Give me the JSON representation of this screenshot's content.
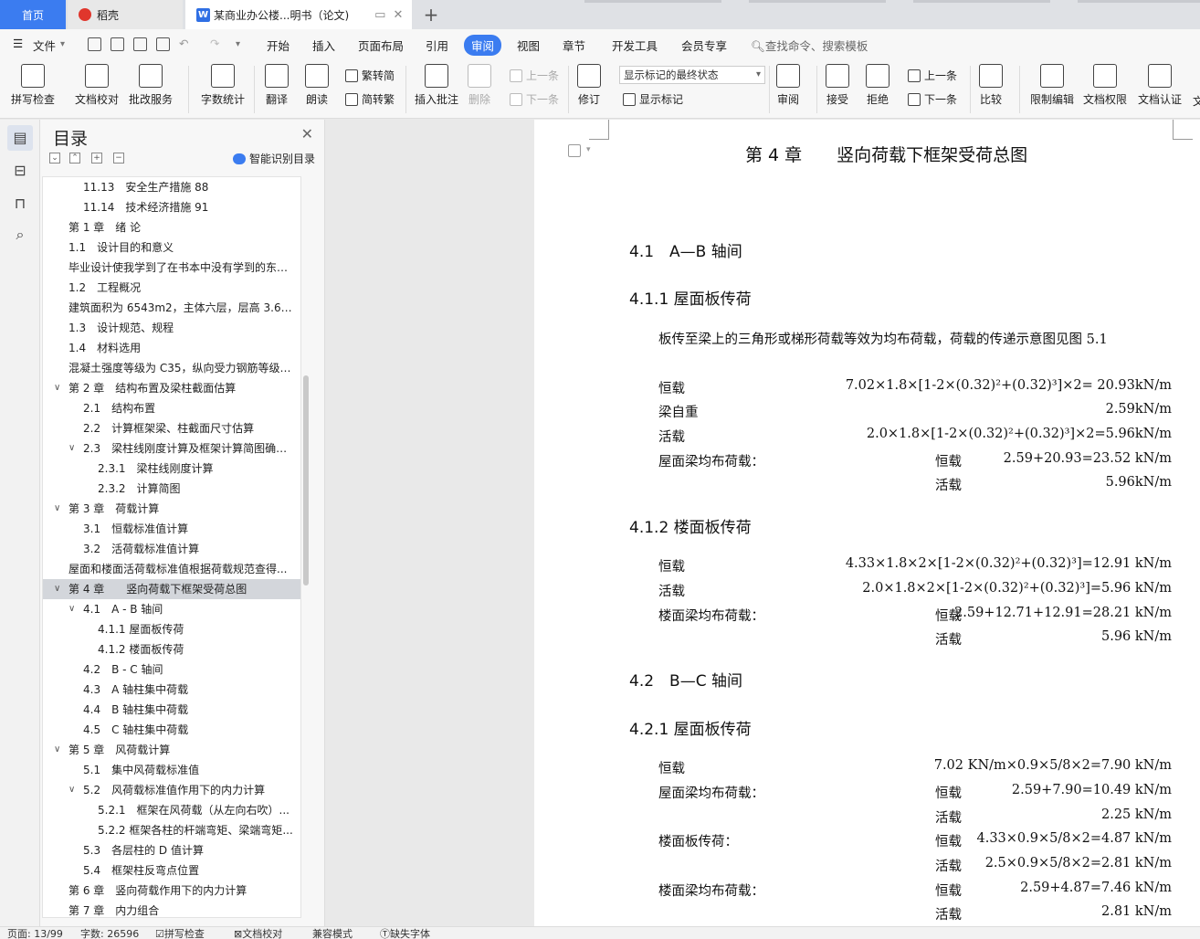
{
  "tabs": {
    "home": "首页",
    "daoke": "稻壳",
    "doc": "某商业办公楼...明书（论文)",
    "doc_icon_letter": "W",
    "new_tab": "+"
  },
  "menu": {
    "file": "文件",
    "start": "开始",
    "insert": "插入",
    "layout": "页面布局",
    "reference": "引用",
    "review": "审阅",
    "view": "视图",
    "chapter": "章节",
    "devtools": "开发工具",
    "member": "会员专享",
    "search": "查找命令、搜索模板"
  },
  "ribbon": {
    "spellcheck": "拼写检查",
    "doc_proof": "文档校对",
    "revise_service": "批改服务",
    "word_count": "字数统计",
    "translate": "翻译",
    "read_aloud": "朗读",
    "to_traditional": "繁转简",
    "to_simplified": "简转繁",
    "insert_comment": "插入批注",
    "delete": "删除",
    "prev_comment": "上一条",
    "next_comment": "下一条",
    "revise": "修订",
    "markup_state": "显示标记的最终状态",
    "show_markup": "显示标记",
    "review_pane": "审阅",
    "accept": "接受",
    "reject": "拒绝",
    "prev_change": "上一条",
    "next_change": "下一条",
    "compare": "比较",
    "restrict_edit": "限制编辑",
    "doc_permission": "文档权限",
    "doc_cert": "文档认证",
    "cut_label": "文"
  },
  "toc": {
    "title": "目录",
    "smart": "智能识别目录",
    "items": [
      {
        "text": "11.13　安全生产措施 88",
        "level": 2,
        "chev": ""
      },
      {
        "text": "11.14　技术经济措施 91",
        "level": 2,
        "chev": ""
      },
      {
        "text": "第 1 章　绪 论",
        "level": 1,
        "chev": ""
      },
      {
        "text": "1.1　设计目的和意义",
        "level": 1,
        "chev": ""
      },
      {
        "text": "毕业设计使我学到了在书本中没有学到的东西...",
        "level": 1,
        "chev": ""
      },
      {
        "text": "1.2　工程概况",
        "level": 1,
        "chev": ""
      },
      {
        "text": "建筑面积为 6543m2，主体六层，层高 3.6m...",
        "level": 1,
        "chev": ""
      },
      {
        "text": "1.3　设计规范、规程",
        "level": 1,
        "chev": ""
      },
      {
        "text": "1.4　材料选用",
        "level": 1,
        "chev": ""
      },
      {
        "text": "混凝土强度等级为 C35，纵向受力钢筋等级为...",
        "level": 1,
        "chev": ""
      },
      {
        "text": "第 2 章　结构布置及梁柱截面估算",
        "level": 1,
        "chev": "v"
      },
      {
        "text": "2.1　结构布置",
        "level": 2,
        "chev": ""
      },
      {
        "text": "2.2　计算框架梁、柱截面尺寸估算",
        "level": 2,
        "chev": ""
      },
      {
        "text": "2.3　梁柱线刚度计算及框架计算简图确定...",
        "level": 2,
        "chev": "v"
      },
      {
        "text": "2.3.1　梁柱线刚度计算",
        "level": 3,
        "chev": ""
      },
      {
        "text": "2.3.2　计算简图",
        "level": 3,
        "chev": ""
      },
      {
        "text": "第 3 章　荷载计算",
        "level": 1,
        "chev": "v"
      },
      {
        "text": "3.1　恒载标准值计算",
        "level": 2,
        "chev": ""
      },
      {
        "text": "3.2　活荷载标准值计算",
        "level": 2,
        "chev": ""
      },
      {
        "text": "屋面和楼面活荷载标准值根据荷载规范查得...",
        "level": 1,
        "chev": ""
      },
      {
        "text": "第 4 章　　竖向荷载下框架受荷总图",
        "level": 1,
        "chev": "v",
        "selected": true
      },
      {
        "text": "4.1　A - B 轴间",
        "level": 2,
        "chev": "v"
      },
      {
        "text": "4.1.1 屋面板传荷",
        "level": 3,
        "chev": ""
      },
      {
        "text": "4.1.2 楼面板传荷",
        "level": 3,
        "chev": ""
      },
      {
        "text": "4.2　B - C 轴间",
        "level": 2,
        "chev": ""
      },
      {
        "text": "4.3　A 轴柱集中荷载",
        "level": 2,
        "chev": ""
      },
      {
        "text": "4.4　B 轴柱集中荷载",
        "level": 2,
        "chev": ""
      },
      {
        "text": "4.5　C 轴柱集中荷载",
        "level": 2,
        "chev": ""
      },
      {
        "text": "第 5 章　风荷载计算",
        "level": 1,
        "chev": "v"
      },
      {
        "text": "5.1　集中风荷载标准值",
        "level": 2,
        "chev": ""
      },
      {
        "text": "5.2　风荷载标准值作用下的内力计算",
        "level": 2,
        "chev": "v"
      },
      {
        "text": "5.2.1　框架在风荷载（从左向右吹）...",
        "level": 3,
        "chev": ""
      },
      {
        "text": "5.2.2 框架各柱的杆端弯矩、梁端弯矩...",
        "level": 3,
        "chev": ""
      },
      {
        "text": "5.3　各层柱的 D 值计算",
        "level": 2,
        "chev": ""
      },
      {
        "text": "5.4　框架柱反弯点位置",
        "level": 2,
        "chev": ""
      },
      {
        "text": "第 6 章　竖向荷载作用下的内力计算",
        "level": 1,
        "chev": ""
      },
      {
        "text": "第 7 章　内力组合",
        "level": 1,
        "chev": ""
      }
    ]
  },
  "doc": {
    "chapter": "第 4 章　　竖向荷载下框架受荷总图",
    "s41": "4.1　A—B 轴间",
    "s411": "4.1.1 屋面板传荷",
    "p1": "板传至梁上的三角形或梯形荷载等效为均布荷载，荷载的传递示意图见图 5.1",
    "l1a": "恒载",
    "l1b": "7.02×1.8×[1-2×(0.32)²+(0.32)³]×2= 20.93kN/m",
    "l2a": "梁自重",
    "l2b": "2.59kN/m",
    "l3a": "活载",
    "l3b": "2.0×1.8×[1-2×(0.32)²+(0.32)³]×2=5.96kN/m",
    "l4a": "屋面梁均布荷载：",
    "l4b": "恒载",
    "l4c": "2.59+20.93=23.52 kN/m",
    "l5b": "活载",
    "l5c": "5.96kN/m",
    "s412": "4.1.2 楼面板传荷",
    "m1a": "恒载",
    "m1b": "4.33×1.8×2×[1-2×(0.32)²+(0.32)³]=12.91 kN/m",
    "m2a": "活载",
    "m2b": "2.0×1.8×2×[1-2×(0.32)²+(0.32)³]=5.96 kN/m",
    "m3a": "楼面梁均布荷载：",
    "m3b": "恒载",
    "m3c": "2.59+12.71+12.91=28.21 kN/m",
    "m4b": "活载",
    "m4c": "5.96 kN/m",
    "s42": "4.2　B—C 轴间",
    "s421": "4.2.1 屋面板传荷",
    "n1a": "恒载",
    "n1b": "7.02 KN/m×0.9×5/8×2=7.90 kN/m",
    "n2a": "屋面梁均布荷载：",
    "n2b": "恒载",
    "n2c": "2.59+7.90=10.49 kN/m",
    "n3b": "活载",
    "n3c": "2.25 kN/m",
    "n4a": "楼面板传荷：",
    "n4b": "恒载",
    "n4c": "4.33×0.9×5/8×2=4.87 kN/m",
    "n5b": "活载",
    "n5c": "2.5×0.9×5/8×2=2.81 kN/m",
    "n6a": "楼面梁均布荷载：",
    "n6b": "恒载",
    "n6c": "2.59+4.87=7.46 kN/m",
    "n7b": "活载",
    "n7c": "2.81 kN/m"
  },
  "status": {
    "page": "页面: 13/99",
    "words": "字数: 26596",
    "spell": "拼写检查",
    "proof": "文档校对",
    "compat": "兼容模式",
    "font_missing": "缺失字体"
  },
  "colors": {
    "accent": "#3b7cf0",
    "selected_row": "#d3d6db"
  }
}
